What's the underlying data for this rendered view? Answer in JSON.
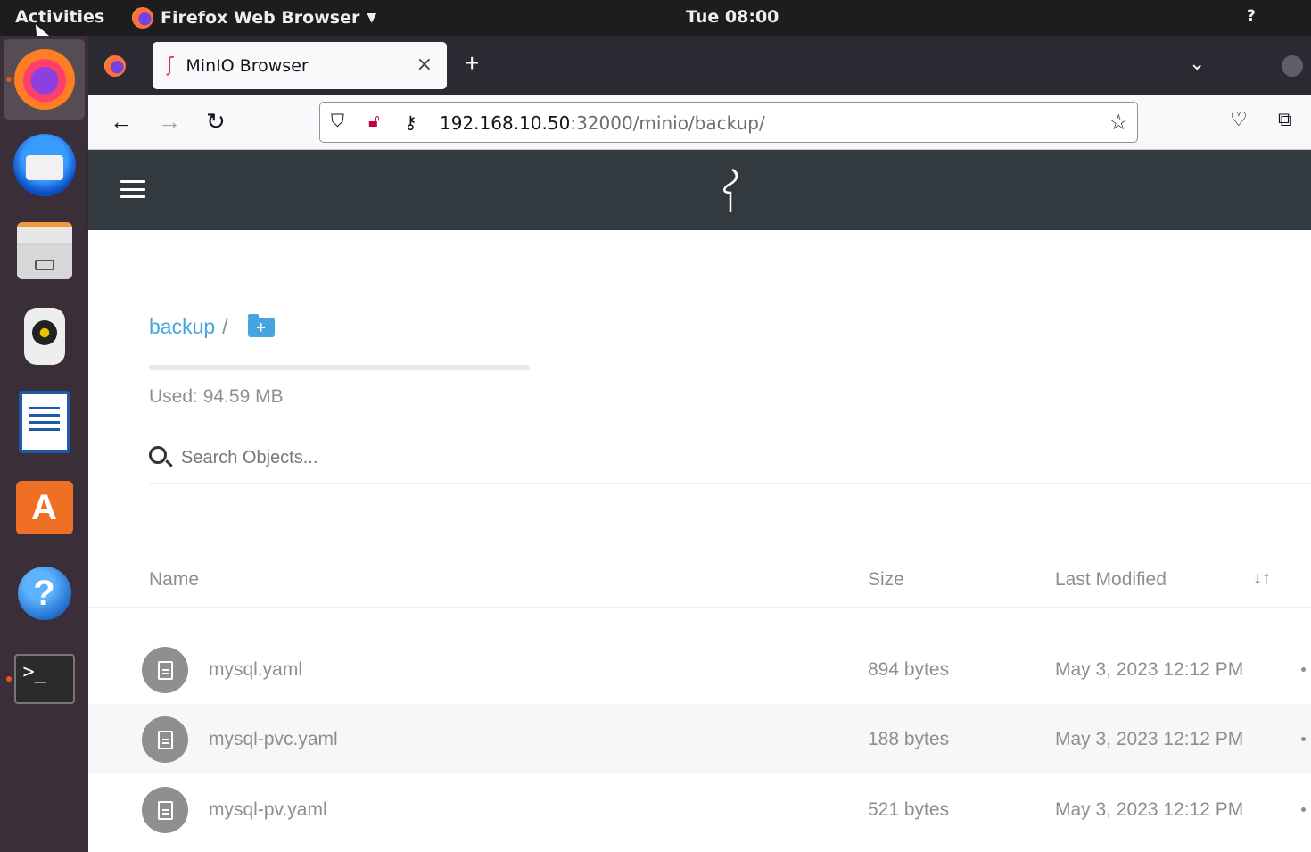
{
  "topbar": {
    "activities": "Activities",
    "app_menu": "Firefox Web Browser",
    "clock": "Tue 08:00",
    "tray_icon": "?"
  },
  "dock": {
    "items": [
      {
        "name": "firefox",
        "icon": "firefox-icon",
        "running": true,
        "active": true
      },
      {
        "name": "thunderbird",
        "icon": "thunderbird-icon",
        "running": false
      },
      {
        "name": "files",
        "icon": "files-icon",
        "running": false
      },
      {
        "name": "rhythmbox",
        "icon": "rhythmbox-icon",
        "running": false
      },
      {
        "name": "libreoffice-writer",
        "icon": "writer-icon",
        "running": false
      },
      {
        "name": "software",
        "icon": "software-store-icon",
        "running": false,
        "glyph": "A"
      },
      {
        "name": "help",
        "icon": "help-icon",
        "running": false,
        "glyph": "?"
      },
      {
        "name": "terminal",
        "icon": "terminal-icon",
        "running": true,
        "glyph": ">_"
      }
    ]
  },
  "browser": {
    "tab_title": "MinIO Browser",
    "tab_close": "×",
    "new_tab": "+",
    "list_tabs": "⌄",
    "url_host": "192.168.10.50",
    "url_path": ":32000/minio/backup/"
  },
  "minio": {
    "bucket": "backup",
    "separator": "/",
    "add_folder": "+",
    "used_label": "Used: 94.59 MB",
    "search_placeholder": "Search Objects...",
    "columns": {
      "name": "Name",
      "size": "Size",
      "last_modified": "Last Modified",
      "sort": "↓↑"
    },
    "objects": [
      {
        "name": "mysql.yaml",
        "size": "894 bytes",
        "modified": "May 3, 2023 12:12 PM"
      },
      {
        "name": "mysql-pvc.yaml",
        "size": "188 bytes",
        "modified": "May 3, 2023 12:12 PM"
      },
      {
        "name": "mysql-pv.yaml",
        "size": "521 bytes",
        "modified": "May 3, 2023 12:12 PM"
      }
    ]
  },
  "colors": {
    "topbar": "#1d1d1d",
    "dock": "#3a2f38",
    "minio_header": "#32393f",
    "link_blue": "#46a5e0",
    "ubuntu_orange": "#e95420"
  }
}
